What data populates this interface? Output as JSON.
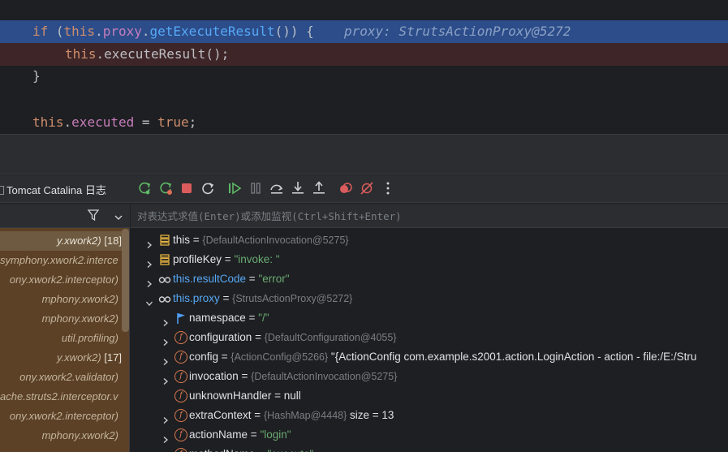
{
  "editor": {
    "lines": [
      {
        "if_kw": "if",
        "open_paren": " (",
        "this_kw": "this",
        "dot1": ".",
        "field": "proxy",
        "dot2": ".",
        "method": "getExecuteResult",
        "rest": "()) {",
        "hint": "proxy: StrutsActionProxy@5272"
      },
      {
        "this_kw": "this",
        "dot": ".",
        "method": "executeResult",
        "rest": "();"
      },
      {
        "text": "}"
      },
      {
        "text": ""
      },
      {
        "this_kw": "this",
        "dot": ".",
        "field": "executed",
        "eq": " = ",
        "value_kw": "true",
        "semi": ";"
      }
    ]
  },
  "toolbar": {
    "tab_title": "Tomcat Catalina 日志",
    "icons": [
      "rerun-icon",
      "rerun-failed-icon",
      "stop-icon",
      "restart-icon",
      "resume-icon",
      "pause-icon",
      "step-over-icon",
      "step-into-icon",
      "step-out-icon",
      "view-breakpoints-icon",
      "mute-breakpoints-icon",
      "more-icon"
    ]
  },
  "frames": {
    "rows": [
      {
        "text": "y.xwork2)",
        "count": "[18]",
        "selected": true
      },
      {
        "text": "symphony.xwork2.interce",
        "count": "",
        "selected": false
      },
      {
        "text": "ony.xwork2.interceptor)",
        "count": "",
        "selected": false
      },
      {
        "text": "mphony.xwork2)",
        "count": "",
        "selected": false
      },
      {
        "text": "mphony.xwork2)",
        "count": "",
        "selected": false
      },
      {
        "text": "util.profiling)",
        "count": "",
        "selected": false
      },
      {
        "text": "y.xwork2)",
        "count": "[17]",
        "selected": false
      },
      {
        "text": "ony.xwork2.validator)",
        "count": "",
        "selected": false
      },
      {
        "text": "ache.struts2.interceptor.v",
        "count": "",
        "selected": false
      },
      {
        "text": "ony.xwork2.interceptor)",
        "count": "",
        "selected": false
      },
      {
        "text": "mphony.xwork2)",
        "count": "",
        "selected": false
      }
    ]
  },
  "variables": {
    "eval_placeholder": "对表达式求值(Enter)或添加监视(Ctrl+Shift+Enter)",
    "rows": [
      {
        "name": "this",
        "eq": " = ",
        "type": "{DefaultActionInvocation@5275}",
        "value": "",
        "value_kind": "",
        "icon": "field-stack-icon",
        "depth": 0,
        "expander": "collapsed"
      },
      {
        "name": "profileKey",
        "eq": " = ",
        "type": "",
        "value": "\"invoke: \"",
        "value_kind": "str",
        "icon": "field-stack-icon",
        "depth": 0,
        "expander": "collapsed"
      },
      {
        "name": "this.resultCode",
        "eq": " = ",
        "type": "",
        "value": "\"error\"",
        "value_kind": "str",
        "icon": "watch-glasses-icon",
        "depth": 0,
        "expander": "collapsed"
      },
      {
        "name": "this.proxy",
        "eq": " = ",
        "type": "{StrutsActionProxy@5272}",
        "value": "",
        "value_kind": "",
        "icon": "watch-glasses-icon",
        "depth": 0,
        "expander": "expanded"
      },
      {
        "name": "namespace",
        "eq": " = ",
        "type": "",
        "value": "\"/\"",
        "value_kind": "str",
        "icon": "flag-icon",
        "depth": 1,
        "expander": "collapsed"
      },
      {
        "name": "configuration",
        "eq": " = ",
        "type": "{DefaultConfiguration@4055}",
        "value": "",
        "value_kind": "",
        "icon": "field-f-icon",
        "depth": 1,
        "expander": "collapsed"
      },
      {
        "name": "config",
        "eq": " = ",
        "type": "{ActionConfig@5266}",
        "value": " \"{ActionConfig com.example.s2001.action.LoginAction - action - file:/E:/Stru",
        "value_kind": "plain",
        "icon": "field-f-icon",
        "depth": 1,
        "expander": "collapsed"
      },
      {
        "name": "invocation",
        "eq": " = ",
        "type": "{DefaultActionInvocation@5275}",
        "value": "",
        "value_kind": "",
        "icon": "field-f-icon",
        "depth": 1,
        "expander": "collapsed"
      },
      {
        "name": "unknownHandler",
        "eq": " = ",
        "type": "",
        "value": "null",
        "value_kind": "plain",
        "icon": "field-f-icon",
        "depth": 1,
        "expander": "none"
      },
      {
        "name": "extraContext",
        "eq": " = ",
        "type": "{HashMap@4448}",
        "value": "  size = 13",
        "value_kind": "plain",
        "icon": "field-f-icon",
        "depth": 1,
        "expander": "collapsed"
      },
      {
        "name": "actionName",
        "eq": " = ",
        "type": "",
        "value": "\"login\"",
        "value_kind": "str",
        "icon": "field-f-icon",
        "depth": 1,
        "expander": "collapsed"
      },
      {
        "name": "methodName",
        "eq": " = ",
        "type": "",
        "value": "\"execute\"",
        "value_kind": "str",
        "icon": "field-f-icon",
        "depth": 1,
        "expander": "collapsed"
      }
    ]
  },
  "colors": {
    "exec_line": "#2c4d8a",
    "breakpoint_line": "#3e2628",
    "frames_bg": "#5c4127",
    "string": "#6aab73",
    "watch": "#56a8f5"
  }
}
